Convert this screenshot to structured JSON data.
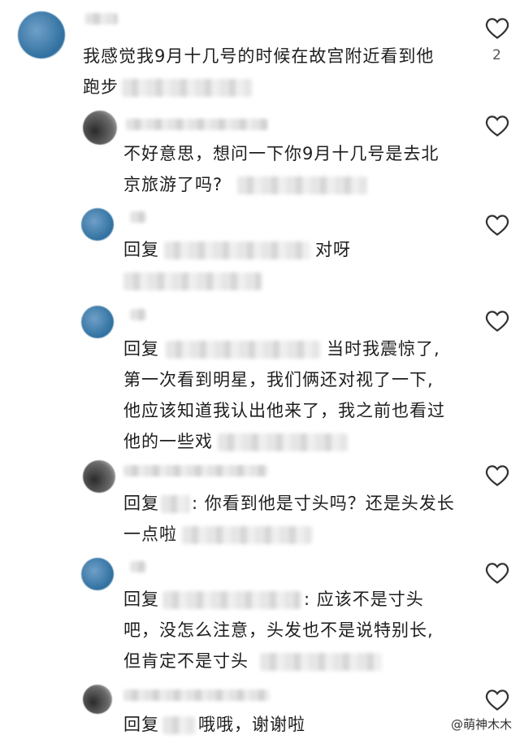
{
  "comments": [
    {
      "text_lines": [
        "我感觉我9月十几号的时候在故宫附近看到他",
        "跑步"
      ],
      "like_count": "2"
    },
    {
      "text_lines": [
        "不好意思，想问一下你9月十几号是去北",
        "京旅游了吗?"
      ]
    },
    {
      "reply_prefix": "回复",
      "text_lines": [
        "对呀"
      ]
    },
    {
      "reply_prefix": "回复",
      "text_lines": [
        "当时我震惊了,",
        "第一次看到明星，我们俩还对视了一下,",
        "他应该知道我认出他来了，我之前也看过",
        "他的一些戏"
      ]
    },
    {
      "reply_prefix": "回复",
      "text_lines": [
        ": 你看到他是寸头吗？还是头发长",
        "一点啦"
      ]
    },
    {
      "reply_prefix": "回复",
      "text_lines": [
        ": 应该不是寸头",
        "吧，没怎么注意，头发也不是说特别长,",
        "但肯定不是寸头"
      ]
    },
    {
      "reply_prefix": "回复",
      "text_lines": [
        "哦哦，谢谢啦"
      ]
    }
  ],
  "watermark": "@萌神木木",
  "icons": {
    "like": "heart-outline-icon"
  }
}
